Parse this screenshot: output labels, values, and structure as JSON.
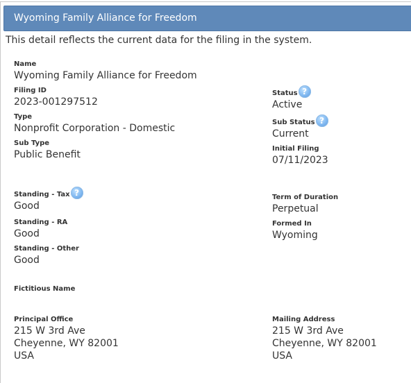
{
  "header": {
    "title": "Wyoming Family Alliance for Freedom"
  },
  "intro": "This detail reflects the current data for the filing in the system.",
  "help_icon_glyph": "?",
  "fields": {
    "name": {
      "label": "Name",
      "value": "Wyoming Family Alliance for Freedom"
    },
    "filing_id": {
      "label": "Filing ID",
      "value": "2023-001297512"
    },
    "type": {
      "label": "Type",
      "value": "Nonprofit Corporation - Domestic"
    },
    "sub_type": {
      "label": "Sub Type",
      "value": "Public Benefit"
    },
    "status": {
      "label": "Status",
      "value": "Active"
    },
    "sub_status": {
      "label": "Sub Status",
      "value": "Current"
    },
    "initial_filing": {
      "label": "Initial Filing",
      "value": "07/11/2023"
    },
    "standing_tax": {
      "label": "Standing - Tax",
      "value": "Good"
    },
    "standing_ra": {
      "label": "Standing - RA",
      "value": "Good"
    },
    "standing_other": {
      "label": "Standing - Other",
      "value": "Good"
    },
    "term_of_duration": {
      "label": "Term of Duration",
      "value": "Perpetual"
    },
    "formed_in": {
      "label": "Formed In",
      "value": "Wyoming"
    },
    "fictitious_name": {
      "label": "Fictitious Name",
      "value": ""
    },
    "principal_office": {
      "label": "Principal Office",
      "lines": [
        "215 W 3rd Ave",
        "Cheyenne, WY 82001",
        "USA"
      ]
    },
    "mailing_address": {
      "label": "Mailing Address",
      "lines": [
        "215 W 3rd Ave",
        "Cheyenne, WY 82001",
        "USA"
      ]
    }
  }
}
